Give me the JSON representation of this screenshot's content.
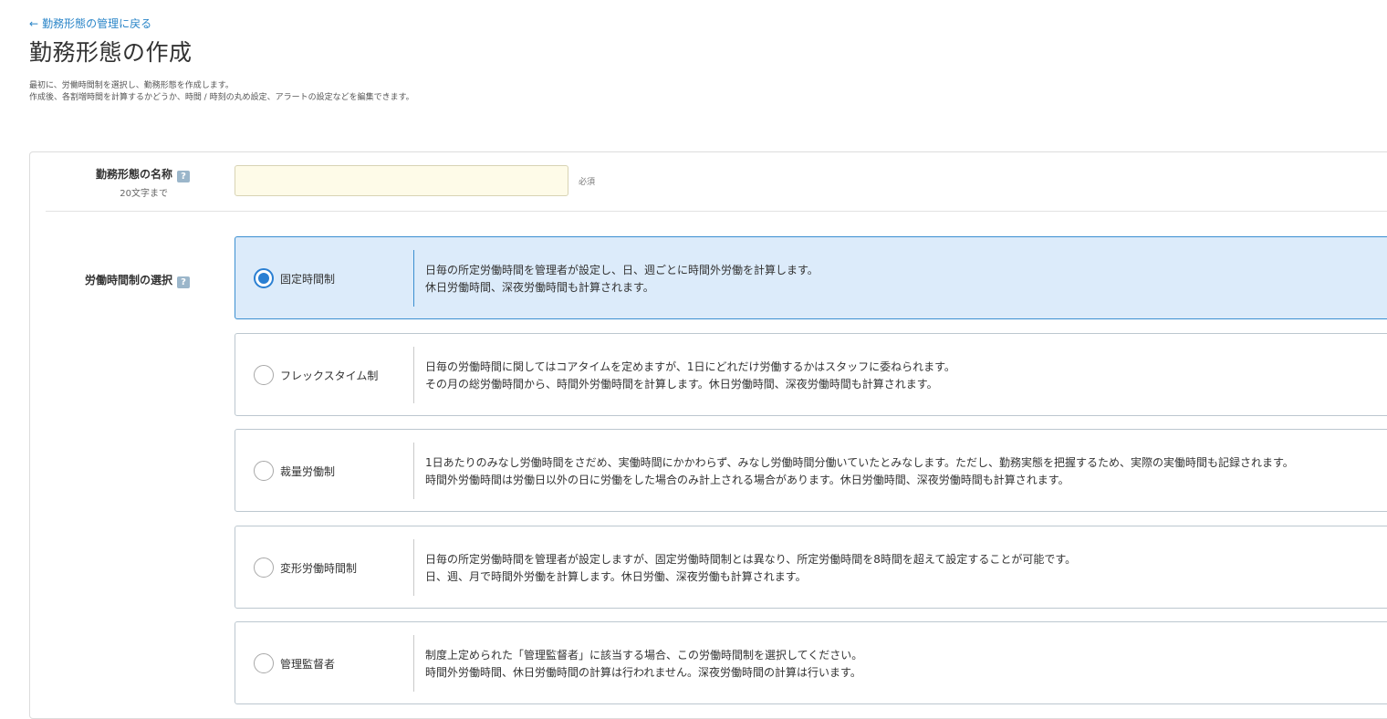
{
  "header": {
    "back_arrow": "←",
    "back_label": "勤務形態の管理に戻る",
    "title": "勤務形態の作成",
    "description_lines": [
      "最初に、労働時間制を選択し、勤務形態を作成します。",
      "作成後、各割増時間を計算するかどうか、時間 / 時刻の丸め設定、アラートの設定などを編集できます。"
    ]
  },
  "form": {
    "name_field": {
      "label": "勤務形態の名称",
      "sub_label": "20文字まで",
      "help_icon": "?",
      "value": "",
      "required_label": "必須"
    },
    "work_system": {
      "label": "労働時間制の選択",
      "help_icon": "?",
      "selected_index": 0,
      "options": [
        {
          "label": "固定時間制",
          "desc_line1": "日毎の所定労働時間を管理者が設定し、日、週ごとに時間外労働を計算します。",
          "desc_line2": "休日労働時間、深夜労働時間も計算されます。"
        },
        {
          "label": "フレックスタイム制",
          "desc_line1": "日毎の労働時間に関してはコアタイムを定めますが、1日にどれだけ労働するかはスタッフに委ねられます。",
          "desc_line2": "その月の総労働時間から、時間外労働時間を計算します。休日労働時間、深夜労働時間も計算されます。"
        },
        {
          "label": "裁量労働制",
          "desc_line1": "1日あたりのみなし労働時間をさだめ、実働時間にかかわらず、みなし労働時間分働いていたとみなします。ただし、勤務実態を把握するため、実際の実働時間も記録されます。",
          "desc_line2": "時間外労働時間は労働日以外の日に労働をした場合のみ計上される場合があります。休日労働時間、深夜労働時間も計算されます。"
        },
        {
          "label": "変形労働時間制",
          "desc_line1": "日毎の所定労働時間を管理者が設定しますが、固定労働時間制とは異なり、所定労働時間を8時間を超えて設定することが可能です。",
          "desc_line2": "日、週、月で時間外労働を計算します。休日労働、深夜労働も計算されます。"
        },
        {
          "label": "管理監督者",
          "desc_line1": "制度上定められた「管理監督者」に該当する場合、この労働時間制を選択してください。",
          "desc_line2": "時間外労働時間、休日労働時間の計算は行われません。深夜労働時間の計算は行います。"
        }
      ]
    }
  },
  "colors": {
    "accent": "#2a7fd2",
    "selected_background": "#dcebfa",
    "input_background": "#fefbe8",
    "link": "#2a85c8"
  }
}
